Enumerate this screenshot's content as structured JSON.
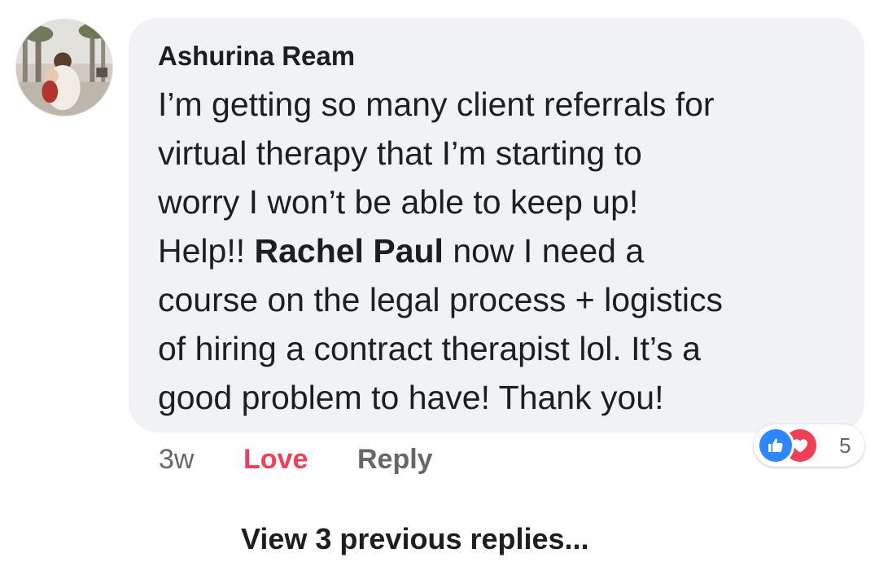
{
  "comment": {
    "author": "Ashurina Ream",
    "lines": [
      "I’m getting so many client referrals for",
      "virtual therapy that I’m starting to",
      "worry I won’t be able to keep up!"
    ],
    "line4_before": "Help!! ",
    "mention": "Rachel Paul",
    "line4_after": " now I need a",
    "lines_after": [
      "course on the legal process + logistics",
      "of hiring a contract therapist lol.  It’s a",
      "good problem to have!  Thank you!"
    ]
  },
  "reactions": {
    "icons": [
      "like-icon",
      "love-icon"
    ],
    "count": "5",
    "colors": {
      "like": "#2d88ff",
      "love": "#f33e58"
    }
  },
  "actions": {
    "time": "3w",
    "love_label": "Love",
    "reply_label": "Reply"
  },
  "view_replies": "View 3 previous replies...",
  "colors": {
    "bubble": "#f0f2f5",
    "text": "#1c1e21",
    "secondary": "#65676b",
    "love": "#f33e58"
  }
}
